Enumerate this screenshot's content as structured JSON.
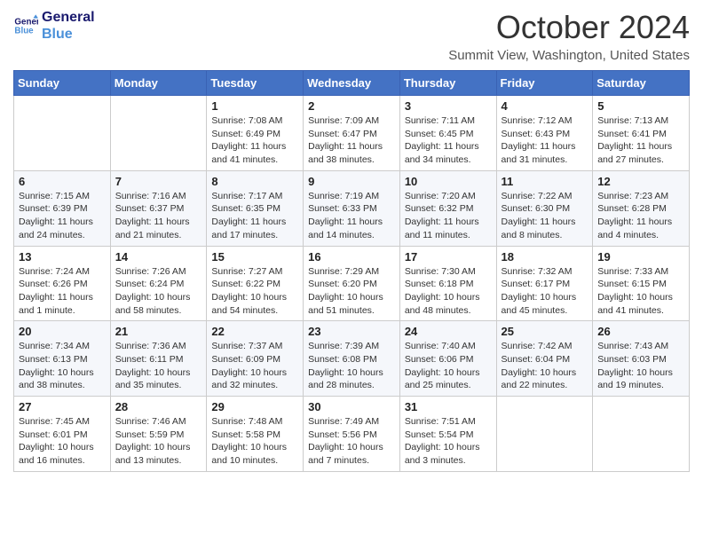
{
  "logo": {
    "line1": "General",
    "line2": "Blue"
  },
  "title": "October 2024",
  "location": "Summit View, Washington, United States",
  "weekdays": [
    "Sunday",
    "Monday",
    "Tuesday",
    "Wednesday",
    "Thursday",
    "Friday",
    "Saturday"
  ],
  "weeks": [
    [
      {
        "day": "",
        "info": ""
      },
      {
        "day": "",
        "info": ""
      },
      {
        "day": "1",
        "info": "Sunrise: 7:08 AM\nSunset: 6:49 PM\nDaylight: 11 hours and 41 minutes."
      },
      {
        "day": "2",
        "info": "Sunrise: 7:09 AM\nSunset: 6:47 PM\nDaylight: 11 hours and 38 minutes."
      },
      {
        "day": "3",
        "info": "Sunrise: 7:11 AM\nSunset: 6:45 PM\nDaylight: 11 hours and 34 minutes."
      },
      {
        "day": "4",
        "info": "Sunrise: 7:12 AM\nSunset: 6:43 PM\nDaylight: 11 hours and 31 minutes."
      },
      {
        "day": "5",
        "info": "Sunrise: 7:13 AM\nSunset: 6:41 PM\nDaylight: 11 hours and 27 minutes."
      }
    ],
    [
      {
        "day": "6",
        "info": "Sunrise: 7:15 AM\nSunset: 6:39 PM\nDaylight: 11 hours and 24 minutes."
      },
      {
        "day": "7",
        "info": "Sunrise: 7:16 AM\nSunset: 6:37 PM\nDaylight: 11 hours and 21 minutes."
      },
      {
        "day": "8",
        "info": "Sunrise: 7:17 AM\nSunset: 6:35 PM\nDaylight: 11 hours and 17 minutes."
      },
      {
        "day": "9",
        "info": "Sunrise: 7:19 AM\nSunset: 6:33 PM\nDaylight: 11 hours and 14 minutes."
      },
      {
        "day": "10",
        "info": "Sunrise: 7:20 AM\nSunset: 6:32 PM\nDaylight: 11 hours and 11 minutes."
      },
      {
        "day": "11",
        "info": "Sunrise: 7:22 AM\nSunset: 6:30 PM\nDaylight: 11 hours and 8 minutes."
      },
      {
        "day": "12",
        "info": "Sunrise: 7:23 AM\nSunset: 6:28 PM\nDaylight: 11 hours and 4 minutes."
      }
    ],
    [
      {
        "day": "13",
        "info": "Sunrise: 7:24 AM\nSunset: 6:26 PM\nDaylight: 11 hours and 1 minute."
      },
      {
        "day": "14",
        "info": "Sunrise: 7:26 AM\nSunset: 6:24 PM\nDaylight: 10 hours and 58 minutes."
      },
      {
        "day": "15",
        "info": "Sunrise: 7:27 AM\nSunset: 6:22 PM\nDaylight: 10 hours and 54 minutes."
      },
      {
        "day": "16",
        "info": "Sunrise: 7:29 AM\nSunset: 6:20 PM\nDaylight: 10 hours and 51 minutes."
      },
      {
        "day": "17",
        "info": "Sunrise: 7:30 AM\nSunset: 6:18 PM\nDaylight: 10 hours and 48 minutes."
      },
      {
        "day": "18",
        "info": "Sunrise: 7:32 AM\nSunset: 6:17 PM\nDaylight: 10 hours and 45 minutes."
      },
      {
        "day": "19",
        "info": "Sunrise: 7:33 AM\nSunset: 6:15 PM\nDaylight: 10 hours and 41 minutes."
      }
    ],
    [
      {
        "day": "20",
        "info": "Sunrise: 7:34 AM\nSunset: 6:13 PM\nDaylight: 10 hours and 38 minutes."
      },
      {
        "day": "21",
        "info": "Sunrise: 7:36 AM\nSunset: 6:11 PM\nDaylight: 10 hours and 35 minutes."
      },
      {
        "day": "22",
        "info": "Sunrise: 7:37 AM\nSunset: 6:09 PM\nDaylight: 10 hours and 32 minutes."
      },
      {
        "day": "23",
        "info": "Sunrise: 7:39 AM\nSunset: 6:08 PM\nDaylight: 10 hours and 28 minutes."
      },
      {
        "day": "24",
        "info": "Sunrise: 7:40 AM\nSunset: 6:06 PM\nDaylight: 10 hours and 25 minutes."
      },
      {
        "day": "25",
        "info": "Sunrise: 7:42 AM\nSunset: 6:04 PM\nDaylight: 10 hours and 22 minutes."
      },
      {
        "day": "26",
        "info": "Sunrise: 7:43 AM\nSunset: 6:03 PM\nDaylight: 10 hours and 19 minutes."
      }
    ],
    [
      {
        "day": "27",
        "info": "Sunrise: 7:45 AM\nSunset: 6:01 PM\nDaylight: 10 hours and 16 minutes."
      },
      {
        "day": "28",
        "info": "Sunrise: 7:46 AM\nSunset: 5:59 PM\nDaylight: 10 hours and 13 minutes."
      },
      {
        "day": "29",
        "info": "Sunrise: 7:48 AM\nSunset: 5:58 PM\nDaylight: 10 hours and 10 minutes."
      },
      {
        "day": "30",
        "info": "Sunrise: 7:49 AM\nSunset: 5:56 PM\nDaylight: 10 hours and 7 minutes."
      },
      {
        "day": "31",
        "info": "Sunrise: 7:51 AM\nSunset: 5:54 PM\nDaylight: 10 hours and 3 minutes."
      },
      {
        "day": "",
        "info": ""
      },
      {
        "day": "",
        "info": ""
      }
    ]
  ]
}
